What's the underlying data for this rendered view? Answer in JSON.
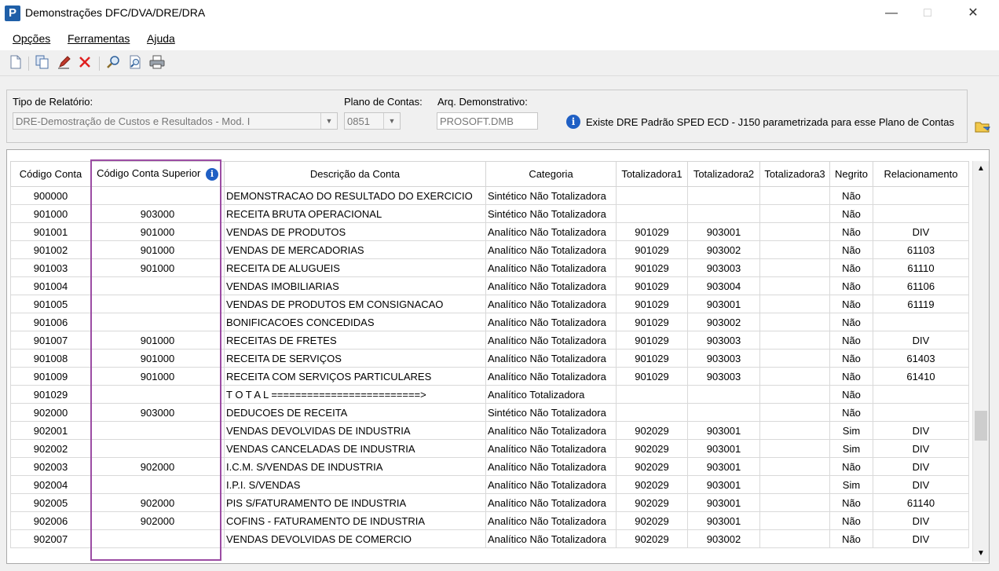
{
  "window": {
    "title": "Demonstrações DFC/DVA/DRE/DRA",
    "app_icon": "P"
  },
  "menu": [
    "Opções",
    "Ferramentas",
    "Ajuda"
  ],
  "toolbar": [
    "new-icon",
    "copy-icon",
    "edit-icon",
    "delete-icon",
    "search-icon",
    "preview-icon",
    "print-icon"
  ],
  "filters": {
    "tipo_label": "Tipo de Relatório:",
    "tipo_value": "DRE-Demostração de Custos e Resultados - Mod. I",
    "plano_label": "Plano de Contas:",
    "plano_value": "0851",
    "arq_label": "Arq. Demonstrativo:",
    "arq_value": "PROSOFT.DMB",
    "info_text": "Existe DRE Padrão SPED ECD - J150 parametrizada para esse Plano de Contas"
  },
  "table": {
    "headers": [
      "Código Conta",
      "Código Conta Superior",
      "Descrição da Conta",
      "Categoria",
      "Totalizadora1",
      "Totalizadora2",
      "Totalizadora3",
      "Negrito",
      "Relacionamento"
    ],
    "rows": [
      [
        "900000",
        "",
        "DEMONSTRACAO DO RESULTADO DO EXERCICIO",
        "Sintético Não Totalizadora",
        "",
        "",
        "",
        "Não",
        ""
      ],
      [
        "901000",
        "903000",
        "RECEITA BRUTA OPERACIONAL",
        "Sintético Não Totalizadora",
        "",
        "",
        "",
        "Não",
        ""
      ],
      [
        "901001",
        "901000",
        "VENDAS DE PRODUTOS",
        "Analítico Não Totalizadora",
        "901029",
        "903001",
        "",
        "Não",
        "DIV"
      ],
      [
        "901002",
        "901000",
        "VENDAS DE MERCADORIAS",
        "Analítico Não Totalizadora",
        "901029",
        "903002",
        "",
        "Não",
        "61103"
      ],
      [
        "901003",
        "901000",
        "RECEITA DE ALUGUEIS",
        "Analítico Não Totalizadora",
        "901029",
        "903003",
        "",
        "Não",
        "61110"
      ],
      [
        "901004",
        "",
        "VENDAS IMOBILIARIAS",
        "Analítico Não Totalizadora",
        "901029",
        "903004",
        "",
        "Não",
        "61106"
      ],
      [
        "901005",
        "",
        "VENDAS DE PRODUTOS EM CONSIGNACAO",
        "Analítico Não Totalizadora",
        "901029",
        "903001",
        "",
        "Não",
        "61119"
      ],
      [
        "901006",
        "",
        "BONIFICACOES CONCEDIDAS",
        "Analítico Não Totalizadora",
        "901029",
        "903002",
        "",
        "Não",
        ""
      ],
      [
        "901007",
        "901000",
        "RECEITAS DE FRETES",
        "Analítico Não Totalizadora",
        "901029",
        "903003",
        "",
        "Não",
        "DIV"
      ],
      [
        "901008",
        "901000",
        "RECEITA DE SERVIÇOS",
        "Analítico Não Totalizadora",
        "901029",
        "903003",
        "",
        "Não",
        "61403"
      ],
      [
        "901009",
        "901000",
        "RECEITA COM SERVIÇOS PARTICULARES",
        "Analítico Não Totalizadora",
        "901029",
        "903003",
        "",
        "Não",
        "61410"
      ],
      [
        "901029",
        "",
        "T O T A L =========================>",
        "Analítico Totalizadora",
        "",
        "",
        "",
        "Não",
        ""
      ],
      [
        "902000",
        "903000",
        "DEDUCOES DE RECEITA",
        "Sintético Não Totalizadora",
        "",
        "",
        "",
        "Não",
        ""
      ],
      [
        "902001",
        "",
        "VENDAS DEVOLVIDAS DE INDUSTRIA",
        "Analítico Não Totalizadora",
        "902029",
        "903001",
        "",
        "Sim",
        "DIV"
      ],
      [
        "902002",
        "",
        "VENDAS CANCELADAS DE INDUSTRIA",
        "Analítico Não Totalizadora",
        "902029",
        "903001",
        "",
        "Sim",
        "DIV"
      ],
      [
        "902003",
        "902000",
        "I.C.M. S/VENDAS DE INDUSTRIA",
        "Analítico Não Totalizadora",
        "902029",
        "903001",
        "",
        "Não",
        "DIV"
      ],
      [
        "902004",
        "",
        "I.P.I. S/VENDAS",
        "Analítico Não Totalizadora",
        "902029",
        "903001",
        "",
        "Sim",
        "DIV"
      ],
      [
        "902005",
        "902000",
        "PIS S/FATURAMENTO DE INDUSTRIA",
        "Analítico Não Totalizadora",
        "902029",
        "903001",
        "",
        "Não",
        "61140"
      ],
      [
        "902006",
        "902000",
        "COFINS - FATURAMENTO DE INDUSTRIA",
        "Analítico Não Totalizadora",
        "902029",
        "903001",
        "",
        "Não",
        "DIV"
      ],
      [
        "902007",
        "",
        "VENDAS DEVOLVIDAS DE COMERCIO",
        "Analítico Não Totalizadora",
        "902029",
        "903002",
        "",
        "Não",
        "DIV"
      ]
    ]
  },
  "colors": {
    "highlight": "#9b4ca3",
    "info": "#1f5fc4"
  }
}
